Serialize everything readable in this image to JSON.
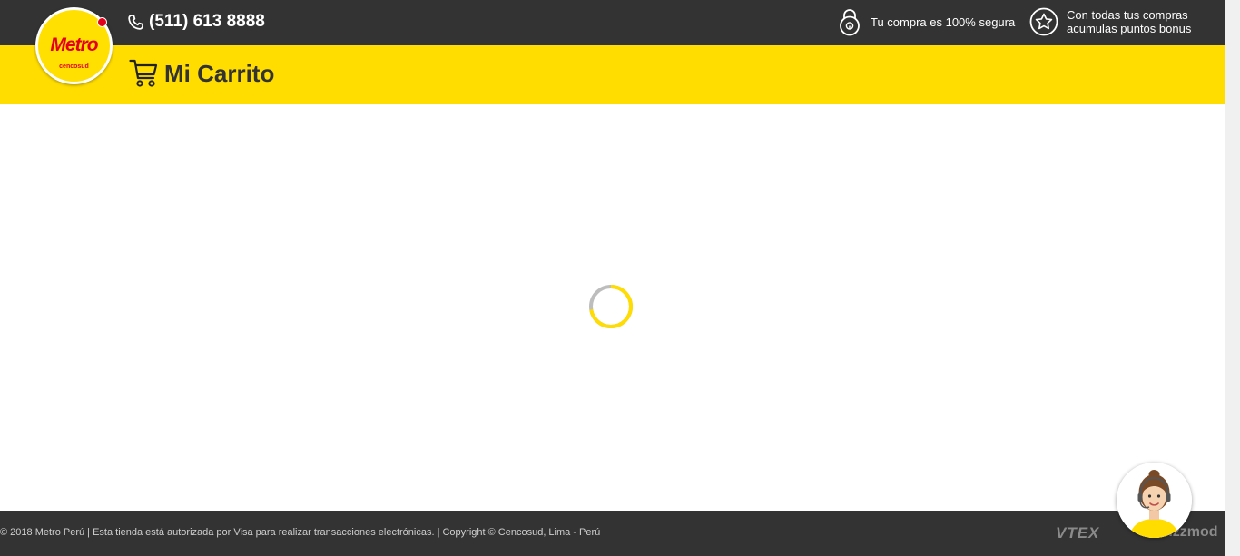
{
  "header": {
    "phone": "(511) 613 8888",
    "secure_text": "Tu compra es 100% segura",
    "bonus_line1": "Con todas tus compras",
    "bonus_line2": "acumulas puntos bonus"
  },
  "brand": {
    "logo_text": "Metro",
    "logo_sub": "cencosud"
  },
  "cart_bar": {
    "title": "Mi Carrito"
  },
  "footer": {
    "copyright": "© 2018 Metro Perú | Esta tienda está autorizada por Visa para realizar transacciones electrónicas. | Copyright © Cencosud, Lima - Perú",
    "vtex": "VTEX",
    "fizzmod": "fizzmod"
  },
  "colors": {
    "dark_bar": "#333333",
    "brand_yellow": "#ffdd00",
    "brand_red": "#e4001b"
  },
  "icons": [
    "phone-icon",
    "lock-icon",
    "star-icon",
    "cart-icon",
    "loading-spinner",
    "assistant-avatar"
  ]
}
